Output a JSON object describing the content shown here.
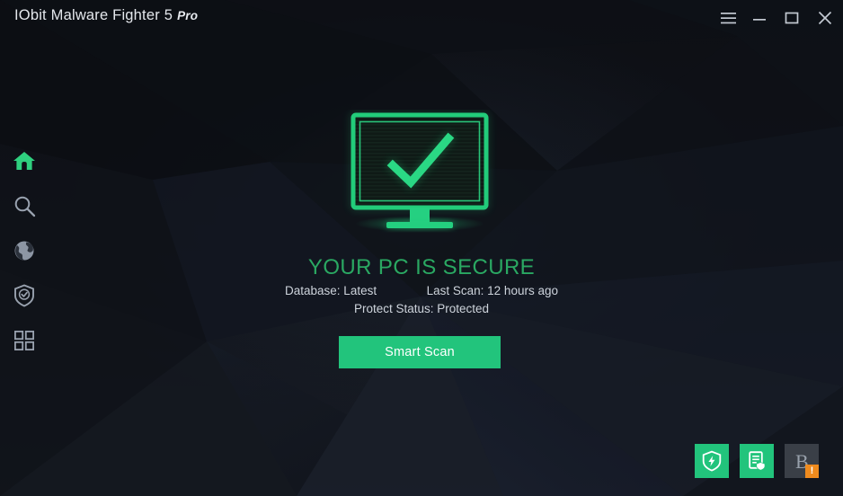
{
  "window": {
    "title_main": "IObit Malware Fighter 5",
    "title_edition": "Pro",
    "controls": [
      {
        "name": "menu-button",
        "label": "Menu"
      },
      {
        "name": "minimize-button",
        "label": "Minimize"
      },
      {
        "name": "maximize-button",
        "label": "Maximize"
      },
      {
        "name": "close-button",
        "label": "Close"
      }
    ]
  },
  "sidebar": {
    "items": [
      {
        "icon": "home-icon",
        "label": "Home",
        "active": true
      },
      {
        "icon": "search-icon",
        "label": "Scan",
        "active": false
      },
      {
        "icon": "globe-icon",
        "label": "Browse",
        "active": false
      },
      {
        "icon": "shield-check-icon",
        "label": "Protect",
        "active": false
      },
      {
        "icon": "grid-icon",
        "label": "Toolbox",
        "active": false
      }
    ]
  },
  "main": {
    "hero_icon": "secure-monitor-icon",
    "status_title": "YOUR PC IS SECURE",
    "database_label": "Database: Latest",
    "last_scan_label": "Last Scan: 12 hours ago",
    "protect_status_label": "Protect Status: Protected",
    "scan_button": "Smart Scan"
  },
  "tray": {
    "items": [
      {
        "icon": "shield-bolt-icon",
        "label": "Security Guard",
        "state": "active",
        "badge": ""
      },
      {
        "icon": "document-shield-icon",
        "label": "Browser Protect",
        "state": "active",
        "badge": ""
      },
      {
        "icon": "browser-b-icon",
        "label": "Surfing Protection",
        "state": "warning",
        "badge": "!"
      }
    ]
  },
  "colors": {
    "background": "#0e1016",
    "accent_green": "#22c47c",
    "status_green": "#2aa862",
    "monitor_green": "#22cc7a",
    "icon_gray": "#9aa3b0",
    "text_primary": "#e4e7ec",
    "text_secondary": "#cdd3db",
    "badge_orange": "#ef8b1e"
  }
}
